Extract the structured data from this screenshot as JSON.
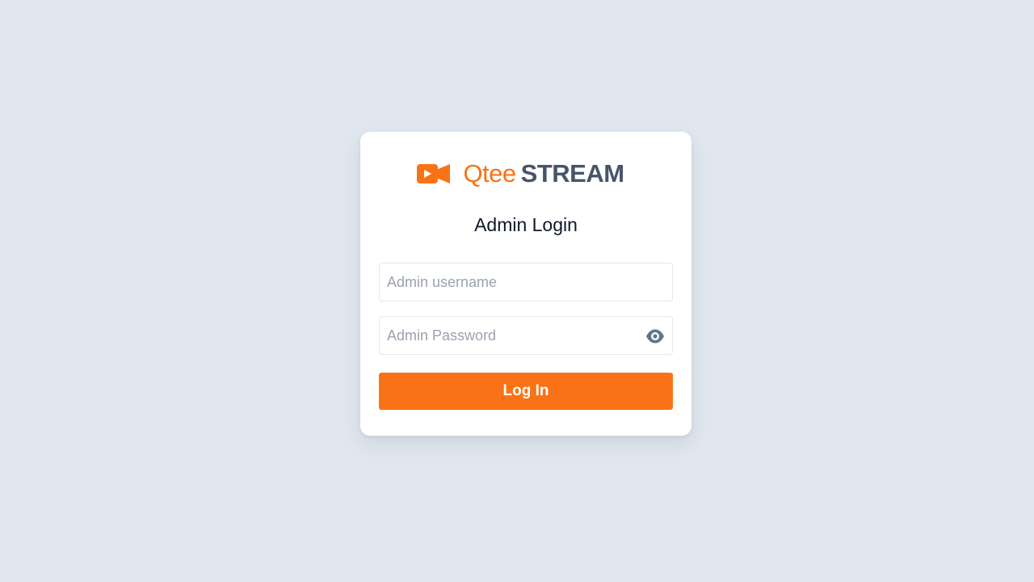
{
  "brand": {
    "name_part1": "Qtee",
    "name_part2": "STREAM",
    "icon": "video-camera-icon"
  },
  "login": {
    "title": "Admin Login",
    "username": {
      "placeholder": "Admin username",
      "value": ""
    },
    "password": {
      "placeholder": "Admin Password",
      "value": "",
      "toggle_icon": "eye-icon"
    },
    "submit_label": "Log In"
  },
  "colors": {
    "background": "#e1e7ef",
    "card": "#ffffff",
    "accent": "#f97316",
    "brand_dark": "#475569",
    "placeholder": "#9ca3af",
    "eye_icon": "#64748b"
  }
}
